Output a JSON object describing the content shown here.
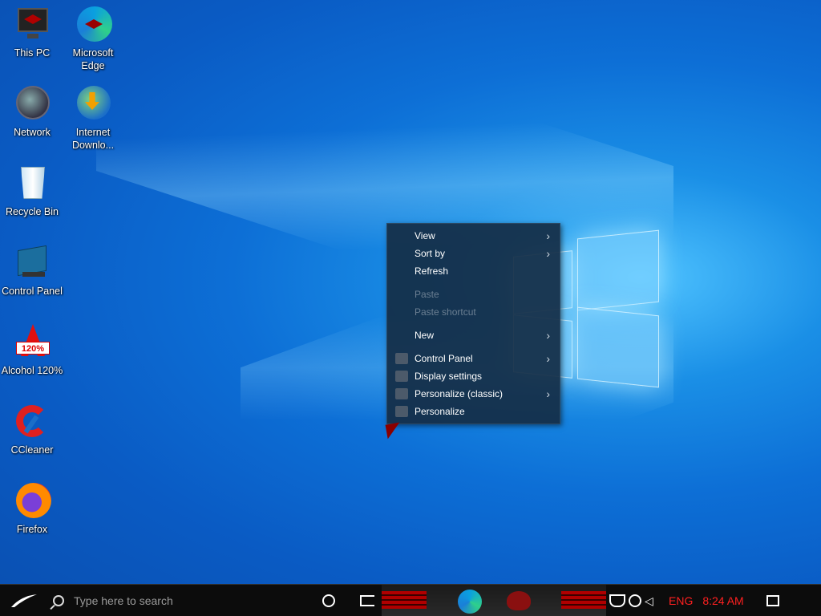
{
  "desktop_icons": [
    {
      "label": "This PC",
      "icon": "computer-icon"
    },
    {
      "label": "Microsoft Edge",
      "icon": "edge-icon"
    },
    {
      "label": "Network",
      "icon": "network-icon"
    },
    {
      "label": "Internet Downlo...",
      "icon": "idm-icon"
    },
    {
      "label": "Recycle Bin",
      "icon": "recycle-bin-icon"
    },
    {
      "label": "Control Panel",
      "icon": "control-panel-icon"
    },
    {
      "label": "Alcohol 120%",
      "icon": "alcohol-icon"
    },
    {
      "label": "CCleaner",
      "icon": "ccleaner-icon"
    },
    {
      "label": "Firefox",
      "icon": "firefox-icon"
    }
  ],
  "context_menu": {
    "items": [
      {
        "label": "View",
        "submenu": true
      },
      {
        "label": "Sort by",
        "submenu": true
      },
      {
        "label": "Refresh"
      },
      {
        "label": "Paste",
        "disabled": true
      },
      {
        "label": "Paste shortcut",
        "disabled": true
      },
      {
        "label": "New",
        "submenu": true
      },
      {
        "label": "Control Panel",
        "submenu": true
      },
      {
        "label": "Display settings"
      },
      {
        "label": "Personalize (classic)",
        "submenu": true
      },
      {
        "label": "Personalize"
      }
    ],
    "arrow": "›"
  },
  "alcohol_badge": "120%",
  "taskbar": {
    "search_placeholder": "Type here to search",
    "language": "ENG",
    "time": "8:24 AM"
  },
  "colors": {
    "accent_red": "#ff2020",
    "menu_bg": "#142d46"
  }
}
